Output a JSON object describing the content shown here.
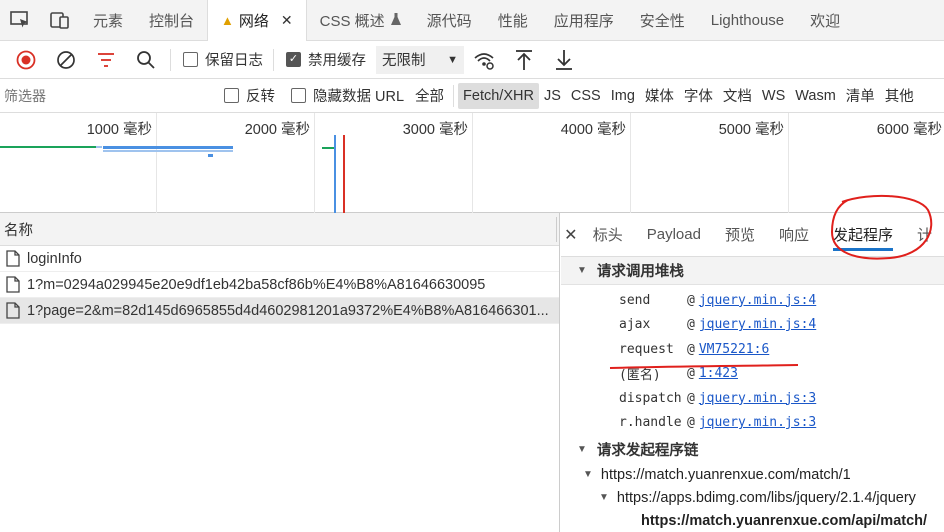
{
  "tabs": [
    {
      "label": "元素"
    },
    {
      "label": "控制台"
    },
    {
      "label": "网络"
    },
    {
      "label": "CSS 概述"
    },
    {
      "label": "源代码"
    },
    {
      "label": "性能"
    },
    {
      "label": "应用程序"
    },
    {
      "label": "安全性"
    },
    {
      "label": "Lighthouse"
    },
    {
      "label": "欢迎"
    }
  ],
  "toolbar": {
    "preserve_log": "保留日志",
    "disable_cache": "禁用缓存",
    "throttle": "无限制"
  },
  "filter": {
    "placeholder": "筛选器",
    "invert": "反转",
    "hide_data_urls": "隐藏数据 URL",
    "types": [
      "全部",
      "Fetch/XHR",
      "JS",
      "CSS",
      "Img",
      "媒体",
      "字体",
      "文档",
      "WS",
      "Wasm",
      "清单",
      "其他"
    ]
  },
  "overview": {
    "ticks": [
      "1000 毫秒",
      "2000 毫秒",
      "3000 毫秒",
      "4000 毫秒",
      "5000 毫秒",
      "6000 毫秒"
    ]
  },
  "requests": {
    "column_name": "名称",
    "rows": [
      {
        "name": "loginInfo"
      },
      {
        "name": "1?m=0294a029945e20e9df1eb42ba58cf86b%E4%B8%A81646630095"
      },
      {
        "name": "1?page=2&m=82d145d6965855d4d4602981201a9372%E4%B8%A816466301..."
      }
    ]
  },
  "detail": {
    "tabs": [
      "标头",
      "Payload",
      "预览",
      "响应",
      "发起程序",
      "计"
    ],
    "call_stack_title": "请求调用堆栈",
    "frames": [
      {
        "fn": "send",
        "at": "@",
        "loc": "jquery.min.js:4"
      },
      {
        "fn": "ajax",
        "at": "@",
        "loc": "jquery.min.js:4"
      },
      {
        "fn": "request",
        "at": "@",
        "loc": "VM75221:6"
      },
      {
        "fn": "(匿名)",
        "at": "@",
        "loc": "1:423"
      },
      {
        "fn": "dispatch",
        "at": "@",
        "loc": "jquery.min.js:3"
      },
      {
        "fn": "r.handle",
        "at": "@",
        "loc": "jquery.min.js:3"
      }
    ],
    "initiator_chain_title": "请求发起程序链",
    "chain": [
      "https://match.yuanrenxue.com/match/1",
      "https://apps.bdimg.com/libs/jquery/2.1.4/jquery",
      "https://match.yuanrenxue.com/api/match/"
    ]
  },
  "colors": {
    "accent": "#1a73c8",
    "record": "#d93025",
    "annotation": "#e0201c"
  }
}
